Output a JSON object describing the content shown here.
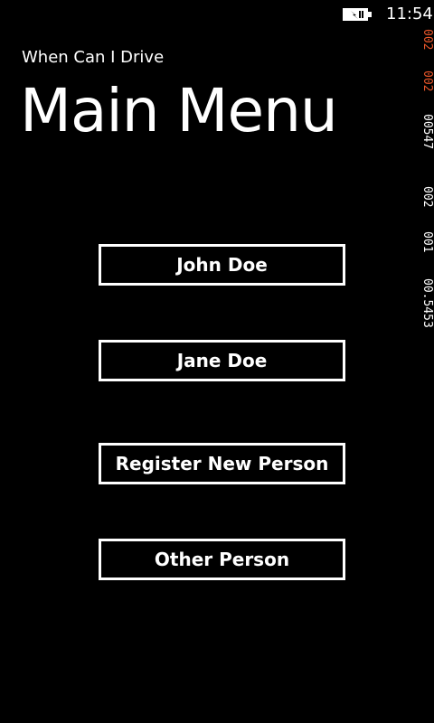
{
  "status_bar": {
    "time": "11:54",
    "battery_icon": "battery-charging-icon"
  },
  "app": {
    "title": "When Can I Drive"
  },
  "page": {
    "title": "Main Menu"
  },
  "menu": {
    "buttons": [
      {
        "label": "John Doe"
      },
      {
        "label": "Jane Doe"
      },
      {
        "label": "Register New Person"
      },
      {
        "label": "Other Person"
      }
    ]
  },
  "frame_counters": {
    "values": [
      "002",
      "002",
      "00547",
      "002",
      "001",
      "00.5453"
    ],
    "colors": [
      "#e8562a",
      "#e8562a",
      "#ffffff",
      "#ffffff",
      "#ffffff",
      "#ffffff"
    ]
  },
  "colors": {
    "background": "#000000",
    "foreground": "#ffffff",
    "counter_accent": "#e8562a"
  }
}
